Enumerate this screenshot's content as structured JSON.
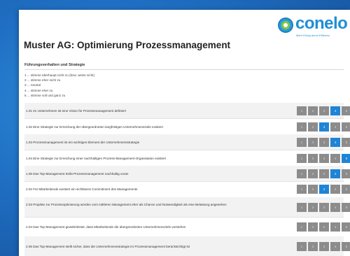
{
  "brand": {
    "name": "conelo",
    "tagline": "Mehr Erfolg durch Effizienz"
  },
  "title": "Muster AG: Optimierung Prozessmanagement",
  "section": "Führungsverhalten und Strategie",
  "scale": [
    "1 ... stimme überhaupt nicht zu (bzw. weiss nicht)",
    "2 ... stimme eher nicht zu",
    "3 ... neutral",
    "4 ... stimme eher zu",
    "5 ... stimme voll und ganz zu"
  ],
  "options": [
    "1",
    "2",
    "3",
    "4",
    "5"
  ],
  "questions": [
    {
      "text": "1.01 Im Unternehmen ist eine Vision für Prozessmanagement definiert",
      "selected": "4"
    },
    {
      "text": "1.02 Eine Strategie zur Erreichung der übergeordneten langfristigen Unternehmensziele existiert",
      "selected": "3"
    },
    {
      "text": "1.03 Prozessmanagement ist ein wichtiges Element der Unternehmensstrategie",
      "selected": "4"
    },
    {
      "text": "1.04 Eine Strategie zur Erreichung einer nachhaltigen Prozess-Management-Organisation existiert",
      "selected": "5"
    },
    {
      "text": "1.05 Das Top-Management treibt Prozessmanagement nachhaltig voran",
      "selected": "4"
    },
    {
      "text": "2.02 Für Mitarbeitende existiert ein sichtbares Commitment des Managements",
      "selected": "3"
    },
    {
      "text": "2.03 Projekte zur Prozessoptimierung werden vom mittleren Management eher als Chance und Notwendigkeit als eine Belastung angesehen",
      "selected": ""
    },
    {
      "text": "2.04 Das Top-Management gewährleistet, dass Mitarbeitende die übergeordneten Unternehmensziele verstehen",
      "selected": ""
    },
    {
      "text": "2.05 Das Top-Management stellt sicher, dass die Unternehmensstrategie im Prozessmanagement berücksichtigt ist",
      "selected": ""
    }
  ]
}
